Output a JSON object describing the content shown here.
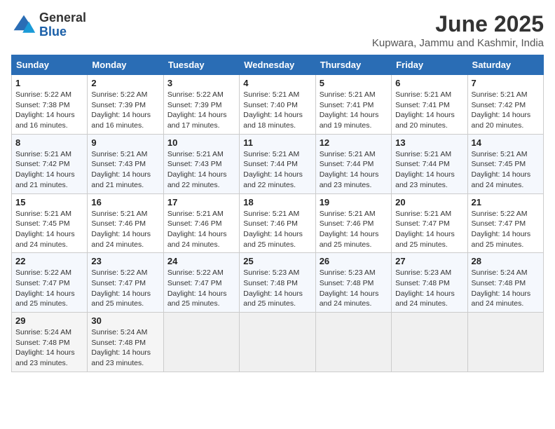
{
  "logo": {
    "general": "General",
    "blue": "Blue"
  },
  "header": {
    "title": "June 2025",
    "subtitle": "Kupwara, Jammu and Kashmir, India"
  },
  "weekdays": [
    "Sunday",
    "Monday",
    "Tuesday",
    "Wednesday",
    "Thursday",
    "Friday",
    "Saturday"
  ],
  "weeks": [
    [
      {
        "day": "1",
        "sunrise": "Sunrise: 5:22 AM",
        "sunset": "Sunset: 7:38 PM",
        "daylight": "Daylight: 14 hours and 16 minutes."
      },
      {
        "day": "2",
        "sunrise": "Sunrise: 5:22 AM",
        "sunset": "Sunset: 7:39 PM",
        "daylight": "Daylight: 14 hours and 16 minutes."
      },
      {
        "day": "3",
        "sunrise": "Sunrise: 5:22 AM",
        "sunset": "Sunset: 7:39 PM",
        "daylight": "Daylight: 14 hours and 17 minutes."
      },
      {
        "day": "4",
        "sunrise": "Sunrise: 5:21 AM",
        "sunset": "Sunset: 7:40 PM",
        "daylight": "Daylight: 14 hours and 18 minutes."
      },
      {
        "day": "5",
        "sunrise": "Sunrise: 5:21 AM",
        "sunset": "Sunset: 7:41 PM",
        "daylight": "Daylight: 14 hours and 19 minutes."
      },
      {
        "day": "6",
        "sunrise": "Sunrise: 5:21 AM",
        "sunset": "Sunset: 7:41 PM",
        "daylight": "Daylight: 14 hours and 20 minutes."
      },
      {
        "day": "7",
        "sunrise": "Sunrise: 5:21 AM",
        "sunset": "Sunset: 7:42 PM",
        "daylight": "Daylight: 14 hours and 20 minutes."
      }
    ],
    [
      {
        "day": "8",
        "sunrise": "Sunrise: 5:21 AM",
        "sunset": "Sunset: 7:42 PM",
        "daylight": "Daylight: 14 hours and 21 minutes."
      },
      {
        "day": "9",
        "sunrise": "Sunrise: 5:21 AM",
        "sunset": "Sunset: 7:43 PM",
        "daylight": "Daylight: 14 hours and 21 minutes."
      },
      {
        "day": "10",
        "sunrise": "Sunrise: 5:21 AM",
        "sunset": "Sunset: 7:43 PM",
        "daylight": "Daylight: 14 hours and 22 minutes."
      },
      {
        "day": "11",
        "sunrise": "Sunrise: 5:21 AM",
        "sunset": "Sunset: 7:44 PM",
        "daylight": "Daylight: 14 hours and 22 minutes."
      },
      {
        "day": "12",
        "sunrise": "Sunrise: 5:21 AM",
        "sunset": "Sunset: 7:44 PM",
        "daylight": "Daylight: 14 hours and 23 minutes."
      },
      {
        "day": "13",
        "sunrise": "Sunrise: 5:21 AM",
        "sunset": "Sunset: 7:44 PM",
        "daylight": "Daylight: 14 hours and 23 minutes."
      },
      {
        "day": "14",
        "sunrise": "Sunrise: 5:21 AM",
        "sunset": "Sunset: 7:45 PM",
        "daylight": "Daylight: 14 hours and 24 minutes."
      }
    ],
    [
      {
        "day": "15",
        "sunrise": "Sunrise: 5:21 AM",
        "sunset": "Sunset: 7:45 PM",
        "daylight": "Daylight: 14 hours and 24 minutes."
      },
      {
        "day": "16",
        "sunrise": "Sunrise: 5:21 AM",
        "sunset": "Sunset: 7:46 PM",
        "daylight": "Daylight: 14 hours and 24 minutes."
      },
      {
        "day": "17",
        "sunrise": "Sunrise: 5:21 AM",
        "sunset": "Sunset: 7:46 PM",
        "daylight": "Daylight: 14 hours and 24 minutes."
      },
      {
        "day": "18",
        "sunrise": "Sunrise: 5:21 AM",
        "sunset": "Sunset: 7:46 PM",
        "daylight": "Daylight: 14 hours and 25 minutes."
      },
      {
        "day": "19",
        "sunrise": "Sunrise: 5:21 AM",
        "sunset": "Sunset: 7:46 PM",
        "daylight": "Daylight: 14 hours and 25 minutes."
      },
      {
        "day": "20",
        "sunrise": "Sunrise: 5:21 AM",
        "sunset": "Sunset: 7:47 PM",
        "daylight": "Daylight: 14 hours and 25 minutes."
      },
      {
        "day": "21",
        "sunrise": "Sunrise: 5:22 AM",
        "sunset": "Sunset: 7:47 PM",
        "daylight": "Daylight: 14 hours and 25 minutes."
      }
    ],
    [
      {
        "day": "22",
        "sunrise": "Sunrise: 5:22 AM",
        "sunset": "Sunset: 7:47 PM",
        "daylight": "Daylight: 14 hours and 25 minutes."
      },
      {
        "day": "23",
        "sunrise": "Sunrise: 5:22 AM",
        "sunset": "Sunset: 7:47 PM",
        "daylight": "Daylight: 14 hours and 25 minutes."
      },
      {
        "day": "24",
        "sunrise": "Sunrise: 5:22 AM",
        "sunset": "Sunset: 7:47 PM",
        "daylight": "Daylight: 14 hours and 25 minutes."
      },
      {
        "day": "25",
        "sunrise": "Sunrise: 5:23 AM",
        "sunset": "Sunset: 7:48 PM",
        "daylight": "Daylight: 14 hours and 25 minutes."
      },
      {
        "day": "26",
        "sunrise": "Sunrise: 5:23 AM",
        "sunset": "Sunset: 7:48 PM",
        "daylight": "Daylight: 14 hours and 24 minutes."
      },
      {
        "day": "27",
        "sunrise": "Sunrise: 5:23 AM",
        "sunset": "Sunset: 7:48 PM",
        "daylight": "Daylight: 14 hours and 24 minutes."
      },
      {
        "day": "28",
        "sunrise": "Sunrise: 5:24 AM",
        "sunset": "Sunset: 7:48 PM",
        "daylight": "Daylight: 14 hours and 24 minutes."
      }
    ],
    [
      {
        "day": "29",
        "sunrise": "Sunrise: 5:24 AM",
        "sunset": "Sunset: 7:48 PM",
        "daylight": "Daylight: 14 hours and 23 minutes."
      },
      {
        "day": "30",
        "sunrise": "Sunrise: 5:24 AM",
        "sunset": "Sunset: 7:48 PM",
        "daylight": "Daylight: 14 hours and 23 minutes."
      },
      null,
      null,
      null,
      null,
      null
    ]
  ]
}
